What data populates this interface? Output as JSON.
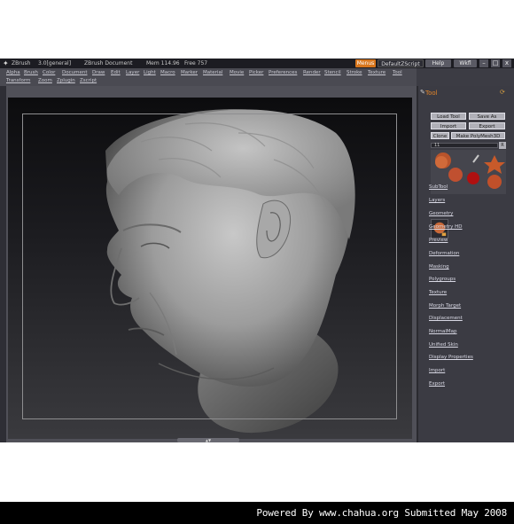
{
  "titlebar": {
    "app_name": "ZBrush",
    "version": "3.0[general]",
    "document": "ZBrush Document",
    "mem": "Mem 114.96",
    "free": "Free 757",
    "btn_menus": "Menus",
    "btn_script": "DefaultZScript",
    "btn_help": "Help",
    "btn_layout": "Wkfl",
    "btn_min": "–",
    "btn_max": "□",
    "btn_close": "x"
  },
  "menubar": {
    "row1": [
      "Alpha",
      "Brush",
      "Color",
      "Document",
      "Draw",
      "Edit",
      "Layer",
      "Light",
      "Macro",
      "Marker",
      "Material",
      "Movie",
      "Picker",
      "Preferences",
      "Render",
      "Stencil",
      "Stroke",
      "Texture",
      "Tool"
    ],
    "row2": [
      "Transform",
      "Zoom",
      "Zplugin",
      "Zscript"
    ]
  },
  "panel": {
    "title": "Tool",
    "load": "Load Tool",
    "saveas": "Save As",
    "import": "Import",
    "export": "Export",
    "clone": "Clone",
    "polymesh": "Make PolyMesh3D",
    "slider_value": "11",
    "slider_btn": "R",
    "subpalettes": [
      "SubTool",
      "Layers",
      "Geometry",
      "Geometry HD",
      "Preview",
      "Deformation",
      "Masking",
      "Polygroups",
      "Texture",
      "Morph Target",
      "Displacement",
      "NormalMap",
      "Unified Skin",
      "Display Properties",
      "Import",
      "Export"
    ]
  },
  "footer": {
    "text": "Powered By www.chahua.org  Submitted May 2008"
  },
  "colors": {
    "accent": "#d8761c",
    "panel_bg": "#3b3b43",
    "menubar_bg": "#4a4a52"
  }
}
